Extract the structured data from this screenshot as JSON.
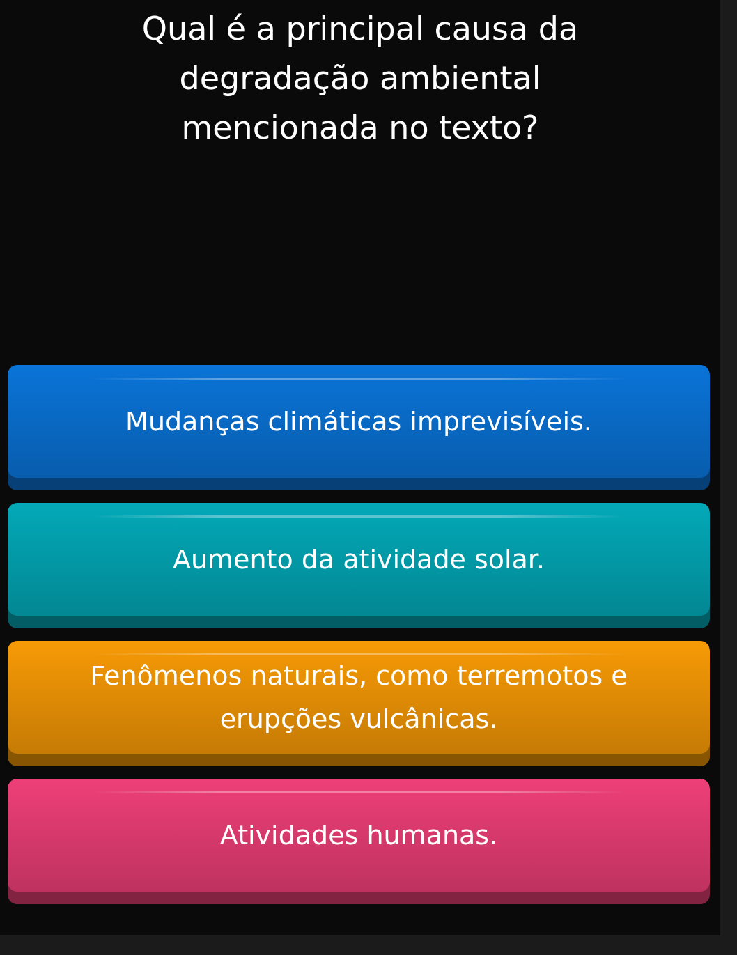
{
  "question": "Qual é a principal causa da degradação ambiental mencionada no texto?",
  "answers": [
    {
      "text": "Mudanças climáticas imprevisíveis.",
      "color": "#0a74d8"
    },
    {
      "text": "Aumento da atividade solar.",
      "color": "#03a9b8"
    },
    {
      "text": "Fenômenos naturais, como terremotos e erupções vulcânicas.",
      "color": "#f79a06"
    },
    {
      "text": "Atividades humanas.",
      "color": "#ee3f78"
    }
  ]
}
